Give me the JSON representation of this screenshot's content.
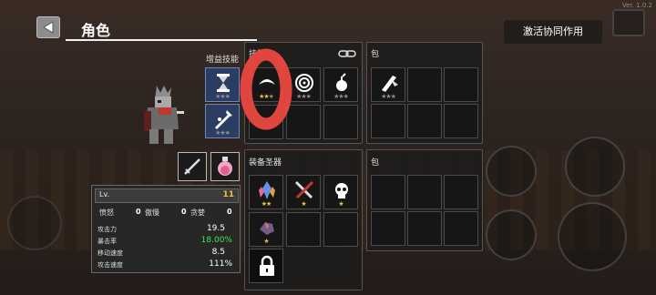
{
  "version": "Ver. 1.0.2",
  "title": "角色",
  "coop_button": "激活协同作用",
  "skills_label": "增益技能",
  "ability_label": "技能",
  "equip_label": "装备圣器",
  "bag_label_1": "包",
  "bag_label_2": "包",
  "stats": {
    "lv_label": "Lv.",
    "lv_value": "11",
    "anger_label": "愤怒",
    "anger_value": "0",
    "pride_label": "傲慢",
    "pride_value": "0",
    "greed_label": "贪婪",
    "greed_value": "0",
    "atk_label": "攻击力",
    "atk_value": "19.5",
    "crit_label": "暴击率",
    "crit_value": "18.00%",
    "move_label": "移动速度",
    "move_value": "8.5",
    "aspd_label": "攻击速度",
    "aspd_value": "111%"
  },
  "colors": {
    "crit": "#3ee55a",
    "level": "#f0c13a",
    "star": "#f0c13a",
    "annotation": "#e0463e"
  },
  "buff_skills": [
    {
      "icon": "hourglass-icon",
      "stars": 3,
      "lit": 0
    },
    {
      "icon": "sword-burst-icon",
      "stars": 3,
      "lit": 0
    }
  ],
  "abilities": [
    {
      "icon": "crescent-slash-icon",
      "stars": 3,
      "lit": 2
    },
    {
      "icon": "target-icon",
      "stars": 3,
      "lit": 0
    },
    {
      "icon": "bomb-icon",
      "stars": 3,
      "lit": 0
    }
  ],
  "bag_items": [
    {
      "icon": "scroll-feather-icon",
      "stars": 3,
      "lit": 0
    }
  ],
  "relics": [
    {
      "icon": "crystal-icon",
      "stars": 2,
      "lit": 2
    },
    {
      "icon": "crossed-swords-icon",
      "stars": 1,
      "lit": 1
    },
    {
      "icon": "skull-icon",
      "stars": 1,
      "lit": 1
    },
    {
      "icon": "gem-ore-icon",
      "stars": 1,
      "lit": 1
    }
  ]
}
